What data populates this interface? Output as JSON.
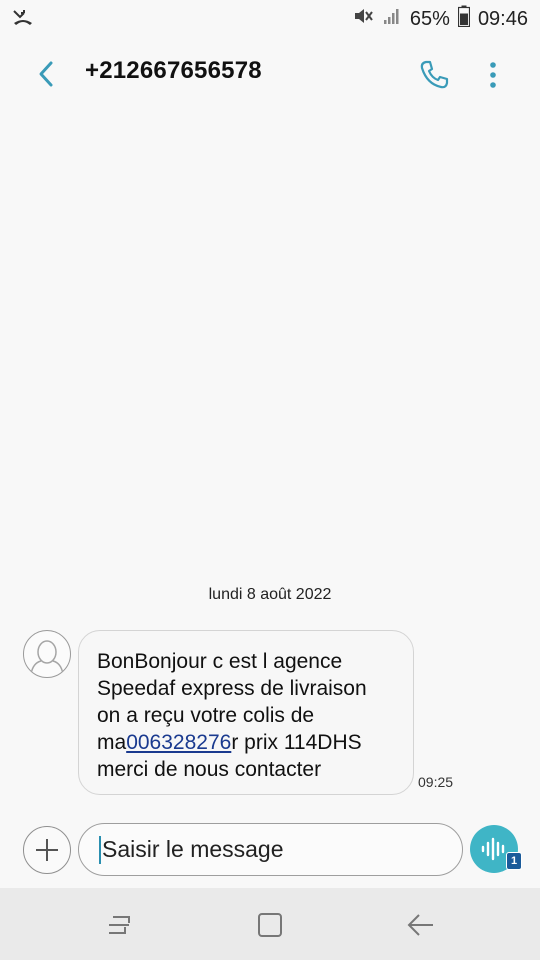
{
  "status_bar": {
    "battery": "65%",
    "time": "09:46",
    "icons": [
      "missed-call-icon",
      "mute-icon",
      "signal-icon",
      "battery-icon"
    ]
  },
  "header": {
    "contact": "+212667656578",
    "icons": [
      "back-arrow-icon",
      "phone-icon",
      "more-vertical-icon"
    ]
  },
  "conversation": {
    "date": "lundi 8 août 2022",
    "messages": [
      {
        "text_before_link": "BonBonjour c est l agence\nSpeedaf express de livraison\non a reçu votre colis de\nma",
        "link": "006328276",
        "text_after_link": "r prix 114DHS\nmerci de nous contacter",
        "time": "09:25"
      }
    ]
  },
  "composer": {
    "placeholder": "Saisir le message",
    "voice_badge": "1",
    "icons": [
      "add-icon",
      "voice-wave-icon"
    ]
  },
  "nav_bar": {
    "icons": [
      "recents-icon",
      "home-icon",
      "back-icon"
    ]
  },
  "colors": {
    "accent": "#3fb5c6",
    "header_icon": "#3a9bb8",
    "link": "#1a3a8f"
  }
}
